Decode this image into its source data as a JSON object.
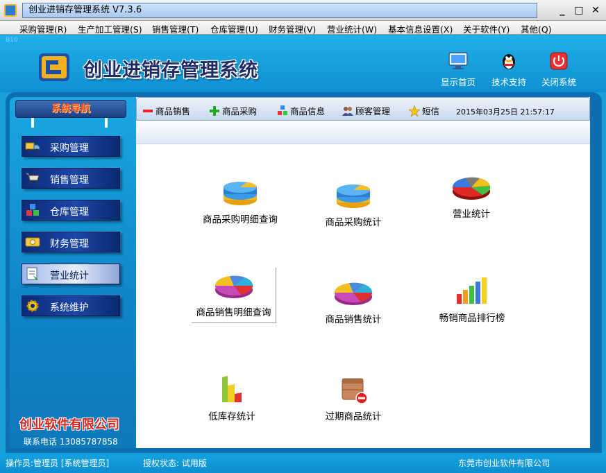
{
  "window": {
    "title": "创业进销存管理系统  V7.3.6",
    "minimize_glyph": "_",
    "maximize_glyph": "□",
    "close_glyph": "✕"
  },
  "menu": [
    "采购管理(R)",
    "生产加工管理(S)",
    "销售管理(T)",
    "仓库管理(U)",
    "财务管理(V)",
    "营业统计(W)",
    "基本信息设置(X)",
    "关于软件(Y)",
    "其他(Q)"
  ],
  "header": {
    "version_tag": "B10",
    "app_title": "创业进销存管理系统",
    "buttons": [
      {
        "label": "显示首页",
        "icon": "monitor-icon"
      },
      {
        "label": "技术支持",
        "icon": "qq-penguin-icon"
      },
      {
        "label": "关闭系统",
        "icon": "power-icon"
      }
    ]
  },
  "sidebar": {
    "title": "系统导航",
    "items": [
      {
        "label": "采购管理",
        "icon": "truck-icon"
      },
      {
        "label": "销售管理",
        "icon": "cart-icon"
      },
      {
        "label": "仓库管理",
        "icon": "boxes-icon"
      },
      {
        "label": "财务管理",
        "icon": "money-icon"
      },
      {
        "label": "营业统计",
        "icon": "report-icon",
        "active": true
      },
      {
        "label": "系统维护",
        "icon": "gear-icon"
      }
    ],
    "company_name": "创业软件有限公司",
    "phone": "联系电话 13085787858"
  },
  "toolbar": {
    "items": [
      {
        "label": "商品销售",
        "icon": "minus-icon"
      },
      {
        "label": "商品采购",
        "icon": "plus-icon"
      },
      {
        "label": "商品信息",
        "icon": "cubes-icon"
      },
      {
        "label": "顾客管理",
        "icon": "users-icon"
      },
      {
        "label": "短信",
        "icon": "star-icon"
      }
    ],
    "datetime": "2015年03月25日  21:57:17"
  },
  "functions": [
    {
      "label": "商品采购明细查询",
      "icon": "stacked-pie-icon"
    },
    {
      "label": "商品采购统计",
      "icon": "stacked-pie-icon"
    },
    {
      "label": "营业统计",
      "icon": "pie-chart-icon"
    },
    {
      "label": "商品销售明细查询",
      "icon": "pie-chart-icon",
      "selected": true
    },
    {
      "label": "商品销售统计",
      "icon": "pie-chart-icon"
    },
    {
      "label": "畅销商品排行榜",
      "icon": "bar-chart-icon"
    },
    {
      "label": "低库存统计",
      "icon": "low-stock-icon"
    },
    {
      "label": "过期商品统计",
      "icon": "expired-box-icon"
    }
  ],
  "status": {
    "operator": "操作员:管理员  [系统管理员]",
    "license": "授权状态: 试用版",
    "company": "东莞市创业软件有限公司"
  },
  "colors": {
    "frame_blue": "#1aa0d8",
    "nav_dark": "#0c2a78",
    "brand_red": "#d8261e"
  }
}
